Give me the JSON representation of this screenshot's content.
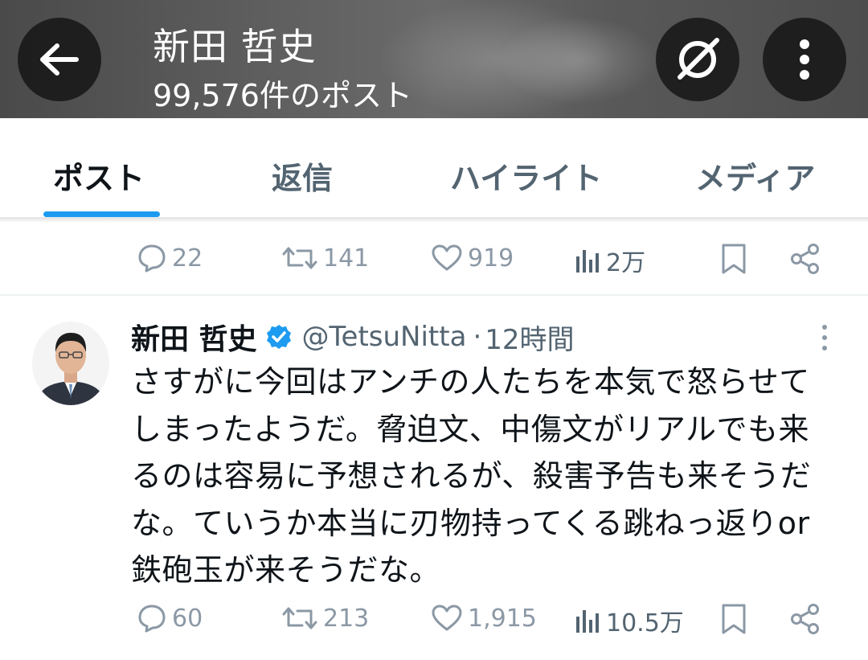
{
  "header": {
    "title": "新田 哲史",
    "post_count": "99,576件のポスト",
    "icons": [
      "back-arrow-icon",
      "grok-icon",
      "more-vertical-icon"
    ]
  },
  "tabs": [
    {
      "label": "ポスト",
      "active": true
    },
    {
      "label": "返信",
      "active": false
    },
    {
      "label": "ハイライト",
      "active": false
    },
    {
      "label": "メディア",
      "active": false
    }
  ],
  "prev_tweet_actions": {
    "replies": "22",
    "reposts": "141",
    "likes": "919",
    "views": "2万"
  },
  "tweet": {
    "name": "新田 哲史",
    "verified": true,
    "handle": "@TetsuNitta",
    "separator": "·",
    "time": "12時間",
    "text": "さすがに今回はアンチの人たちを本気で怒らせて\nしまったようだ。脅迫文、中傷文がリアルでも来\nるのは容易に予想されるが、殺害予告も来そうだ\nな。ていうか本当に刃物持ってくる跳ねっ返りor\n鉄砲玉が来そうだな。",
    "actions": {
      "replies": "60",
      "reposts": "213",
      "likes": "1,915",
      "views": "10.5万"
    }
  },
  "colors": {
    "accent": "#1d9bf0",
    "text": "#0f1419",
    "secondary": "#536471",
    "icon": "#8b98a5"
  }
}
